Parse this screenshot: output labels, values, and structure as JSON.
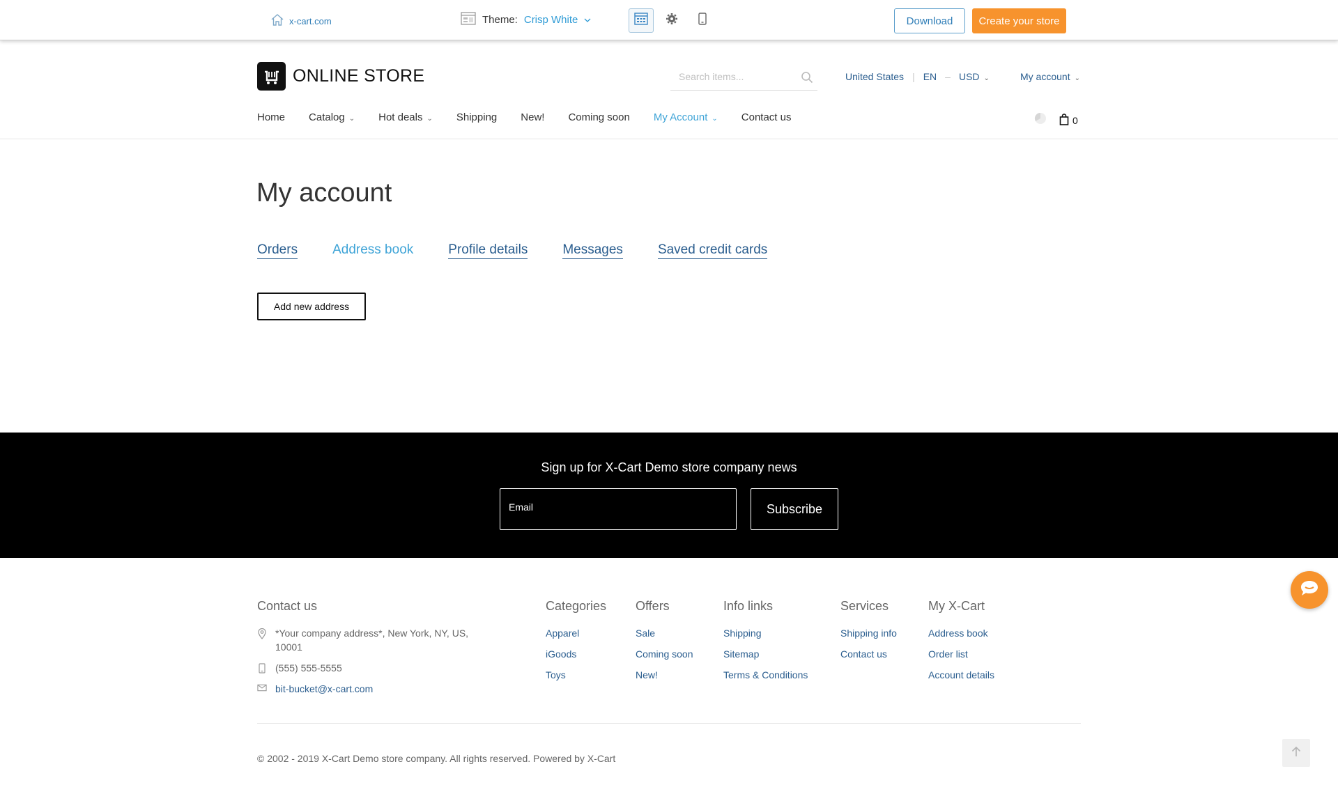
{
  "demo_bar": {
    "home_link": "x-cart.com",
    "theme_label": "Theme:",
    "theme_value": "Crisp White",
    "download": "Download",
    "create_store": "Create your store"
  },
  "header": {
    "logo_text": "ONLINE STORE",
    "search_placeholder": "Search items...",
    "country": "United States",
    "language": "EN",
    "currency": "USD",
    "account": "My account",
    "cart_count": "0"
  },
  "nav": {
    "items": [
      "Home",
      "Catalog",
      "Hot deals",
      "Shipping",
      "New!",
      "Coming soon",
      "My Account",
      "Contact us"
    ]
  },
  "main": {
    "title": "My account",
    "tabs": [
      "Orders",
      "Address book",
      "Profile details",
      "Messages",
      "Saved credit cards"
    ],
    "current_tab": "Address book",
    "add_address": "Add new address"
  },
  "newsletter": {
    "title": "Sign up for X-Cart Demo store company news",
    "email_placeholder": "Email",
    "subscribe": "Subscribe"
  },
  "footer": {
    "contact_title": "Contact us",
    "address_line1": "*Your company address*, New York, NY, US,",
    "address_line2": "10001",
    "phone": "(555) 555-5555",
    "email": "bit-bucket@x-cart.com",
    "columns": [
      {
        "title": "Categories",
        "links": [
          "Apparel",
          "iGoods",
          "Toys"
        ]
      },
      {
        "title": "Offers",
        "links": [
          "Sale",
          "Coming soon",
          "New!"
        ]
      },
      {
        "title": "Info links",
        "links": [
          "Shipping",
          "Sitemap",
          "Terms & Conditions"
        ]
      },
      {
        "title": "Services",
        "links": [
          "Shipping info",
          "Contact us"
        ]
      },
      {
        "title": "My X-Cart",
        "links": [
          "Address book",
          "Order list",
          "Account details"
        ]
      }
    ],
    "copyright": "© 2002 - 2019 X-Cart Demo store company. All rights reserved. Powered by X-Cart"
  },
  "colors": {
    "link": "#2b5e8f",
    "active": "#3fa4d7",
    "accent_orange": "#f7932d",
    "newsletter_bg": "#000000"
  }
}
